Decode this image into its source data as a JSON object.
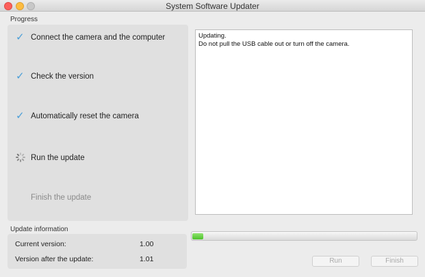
{
  "window": {
    "title": "System Software Updater"
  },
  "progress": {
    "heading": "Progress",
    "steps": [
      {
        "label": "Connect the camera and the computer",
        "status": "done",
        "icon": "checkmark-icon"
      },
      {
        "label": "Check the version",
        "status": "done",
        "icon": "checkmark-icon"
      },
      {
        "label": "Automatically reset the camera",
        "status": "done",
        "icon": "checkmark-icon"
      },
      {
        "label": "Run the update",
        "status": "in-progress",
        "icon": "spinner-icon"
      },
      {
        "label": "Finish the update",
        "status": "pending",
        "icon": ""
      }
    ]
  },
  "log": {
    "line1": "Updating.",
    "line2": "Do not pull the USB cable out or turn off the camera."
  },
  "update_info": {
    "heading": "Update information",
    "current_label": "Current version:",
    "current_value": "1.00",
    "after_label": "Version after the update:",
    "after_value": "1.01"
  },
  "progress_bar": {
    "fraction": 0.05,
    "fill_color": "#4cc22a"
  },
  "buttons": {
    "run_label": "Run",
    "finish_label": "Finish"
  },
  "colors": {
    "check": "#4a9ed8",
    "close": "#fc605b",
    "minimize": "#fdbc40"
  }
}
